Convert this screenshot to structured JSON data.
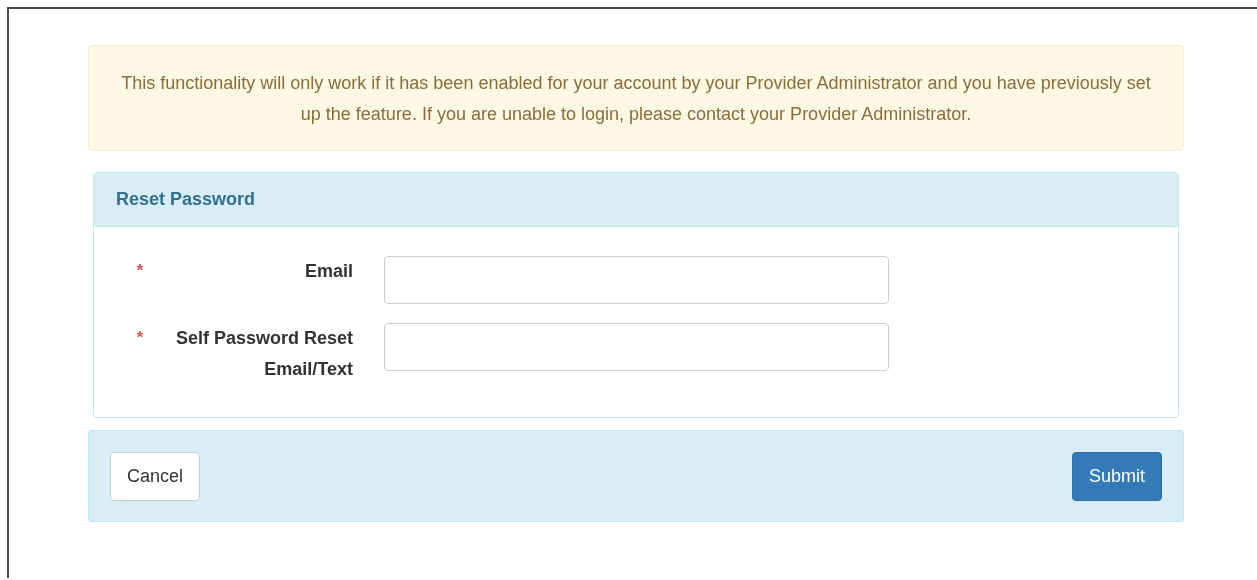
{
  "alert": {
    "text": "This functionality will only work if it has been enabled for your account by your Provider Administrator and you have previously set up the feature. If you are unable to login, please contact your Provider Administrator."
  },
  "panel": {
    "title": "Reset Password",
    "fields": [
      {
        "required_mark": "*",
        "label": "Email"
      },
      {
        "required_mark": "*",
        "label": "Self Password Reset Email/Text"
      }
    ]
  },
  "footer": {
    "buttons": [
      {
        "label": "Cancel",
        "kind": "default"
      },
      {
        "label": "Submit",
        "kind": "primary"
      }
    ]
  }
}
